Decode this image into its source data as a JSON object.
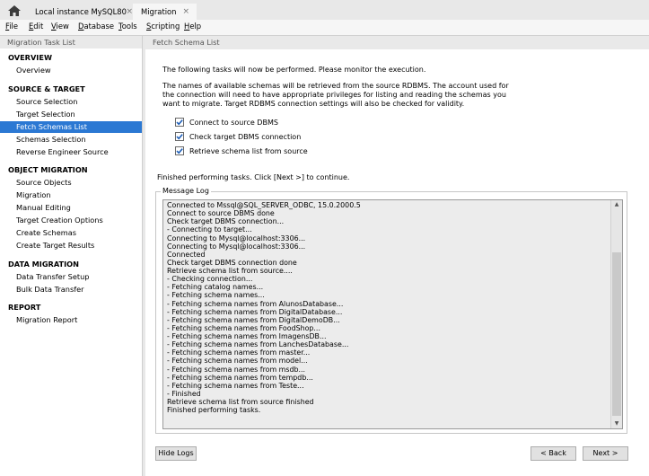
{
  "tabs": [
    {
      "label": "Local instance MySQL80",
      "close": "×",
      "active": false
    },
    {
      "label": "Migration",
      "close": "×",
      "active": true
    }
  ],
  "menu": [
    {
      "label": "File",
      "underline": "F",
      "rest": "ile"
    },
    {
      "label": "Edit",
      "underline": "E",
      "rest": "dit"
    },
    {
      "label": "View",
      "underline": "V",
      "rest": "iew"
    },
    {
      "label": "Database",
      "underline": "D",
      "rest": "atabase"
    },
    {
      "label": "Tools",
      "underline": "T",
      "rest": "ools"
    },
    {
      "label": "Scripting",
      "underline": "S",
      "rest": "cripting"
    },
    {
      "label": "Help",
      "underline": "H",
      "rest": "elp"
    }
  ],
  "sidebar": {
    "header": "Migration Task List",
    "sections": [
      {
        "title": "OVERVIEW",
        "items": [
          "Overview"
        ]
      },
      {
        "title": "SOURCE & TARGET",
        "items": [
          "Source Selection",
          "Target Selection",
          "Fetch Schemas List",
          "Schemas Selection",
          "Reverse Engineer Source"
        ]
      },
      {
        "title": "OBJECT MIGRATION",
        "items": [
          "Source Objects",
          "Migration",
          "Manual Editing",
          "Target Creation Options",
          "Create Schemas",
          "Create Target Results"
        ]
      },
      {
        "title": "DATA MIGRATION",
        "items": [
          "Data Transfer Setup",
          "Bulk Data Transfer"
        ]
      },
      {
        "title": "REPORT",
        "items": [
          "Migration Report"
        ]
      }
    ],
    "selected": "Fetch Schemas List"
  },
  "main": {
    "header": "Fetch Schema List",
    "intro": "The following tasks will now be performed. Please monitor the execution.",
    "desc_lines": [
      "The names of available schemas will be retrieved from the source RDBMS. The account used for",
      "the connection will need to have appropriate privileges for listing and reading the schemas you",
      "want to migrate. Target RDBMS connection settings will also be checked for validity."
    ],
    "tasks": [
      "Connect to source DBMS",
      "Check target DBMS connection",
      "Retrieve schema list from source"
    ],
    "status": "Finished performing tasks. Click [Next >] to continue.",
    "log_title": "Message Log",
    "log": [
      "Connected to Mssql@SQL_SERVER_ODBC, 15.0.2000.5",
      "Connect to source DBMS done",
      "Check target DBMS connection...",
      "- Connecting to target...",
      "Connecting to Mysql@localhost:3306...",
      "Connecting to Mysql@localhost:3306...",
      "Connected",
      "Check target DBMS connection done",
      "Retrieve schema list from source....",
      "- Checking connection...",
      "- Fetching catalog names...",
      "- Fetching schema names...",
      "- Fetching schema names from AlunosDatabase...",
      "- Fetching schema names from DigitalDatabase...",
      "- Fetching schema names from DigitalDemoDB...",
      "- Fetching schema names from FoodShop...",
      "- Fetching schema names from ImagensDB...",
      "- Fetching schema names from LanchesDatabase...",
      "- Fetching schema names from master...",
      "- Fetching schema names from model...",
      "- Fetching schema names from msdb...",
      "- Fetching schema names from tempdb...",
      "- Fetching schema names from Teste...",
      "- Finished",
      "Retrieve schema list from source finished",
      "Finished performing tasks."
    ],
    "buttons": {
      "hide_logs": "Hide Logs",
      "back": "< Back",
      "next": "Next >"
    }
  },
  "colors": {
    "selection": "#2b78d3",
    "check": "#1f5fb8"
  },
  "icons": {
    "home": "home-icon",
    "task_done": "checkbox-checked-icon"
  }
}
